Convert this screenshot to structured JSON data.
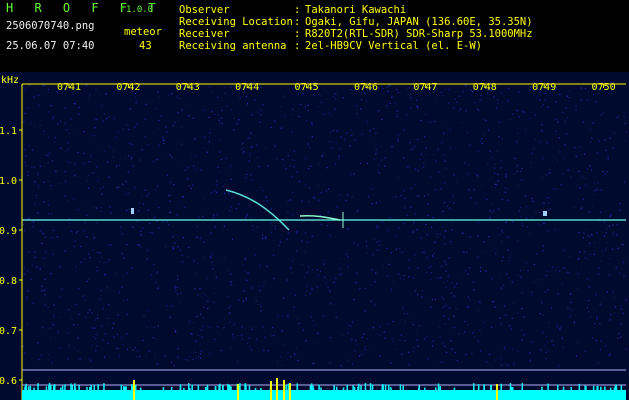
{
  "app": {
    "title": "H R O F F T",
    "version": "1.0.0"
  },
  "file": {
    "name": "2506070740.png",
    "datetime": "25.06.07 07:40"
  },
  "detection": {
    "type": "meteor",
    "count": "43"
  },
  "info": [
    {
      "key": "Observer",
      "value": "Takanori Kawachi"
    },
    {
      "key": "Receiving Location",
      "value": "Ogaki, Gifu, JAPAN (136.60E, 35.35N)"
    },
    {
      "key": "Receiver",
      "value": "R820T2(RTL-SDR) SDR-Sharp 53.1000MHz"
    },
    {
      "key": "Receiving antenna",
      "value": "2el-HB9CV Vertical (el. E-W)"
    }
  ],
  "spectrogram": {
    "y_unit": "kHz",
    "time_ticks": [
      "0741",
      "0742",
      "0743",
      "0744",
      "0745",
      "0746",
      "0747",
      "0748",
      "0749",
      "0750"
    ],
    "freq_ticks": [
      "1.1",
      "1.0",
      "0.9",
      "0.8",
      "0.7",
      "0.6"
    ],
    "carrier_freq_khz": 0.92,
    "colors": {
      "background": "#000a2e",
      "noise": "#2233cc",
      "carrier": "#66ffee",
      "axis": "#ffff00",
      "level": "#00ffff",
      "spike": "#ffff00"
    }
  }
}
